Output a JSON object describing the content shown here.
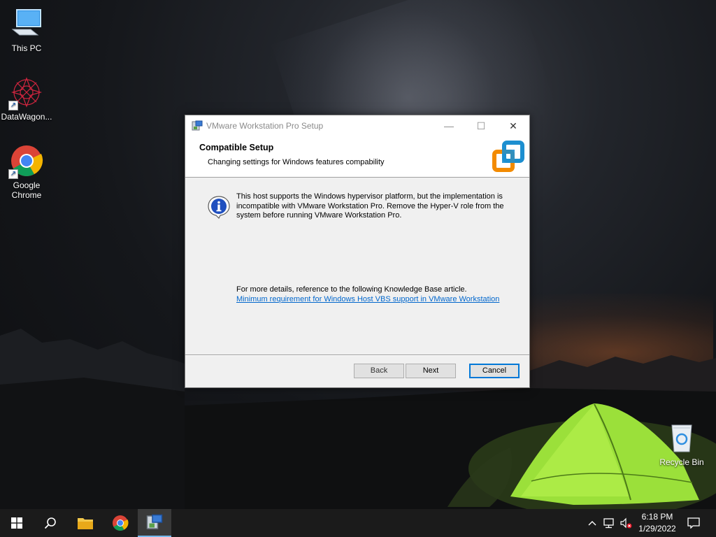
{
  "desktop": {
    "icons": [
      {
        "label": "This PC"
      },
      {
        "label": "DataWagon..."
      },
      {
        "label": "Google\nChrome"
      },
      {
        "label": "Recycle Bin"
      }
    ]
  },
  "dialog": {
    "title": "VMware Workstation Pro Setup",
    "controls": {
      "minimize": "—",
      "maximize": "☐",
      "close": "✕"
    },
    "header": {
      "title": "Compatible Setup",
      "subtitle": "Changing settings for Windows features compability"
    },
    "message": "This host supports the Windows hypervisor platform, but the implementation is incompatible with VMware Workstation Pro.  Remove the Hyper-V role from the system before running VMware Workstation Pro.",
    "details_text": "For more details, reference to the following Knowledge Base article.",
    "kb_link": "Minimum requirement for Windows Host VBS support in VMware Workstation",
    "buttons": {
      "back": "Back",
      "next": "Next",
      "cancel": "Cancel"
    }
  },
  "taskbar": {
    "items": [
      "windows-start",
      "search",
      "file-explorer",
      "google-chrome",
      "vmware-setup"
    ],
    "active_item": "vmware-setup",
    "clock": {
      "time": "6:18 PM",
      "date": "1/29/2022"
    }
  },
  "colors": {
    "accent": "#0078d7",
    "link": "#0066cc",
    "vmware_blue": "#1d8fd0",
    "vmware_orange": "#f38b00",
    "tent_green": "#9be03a"
  }
}
